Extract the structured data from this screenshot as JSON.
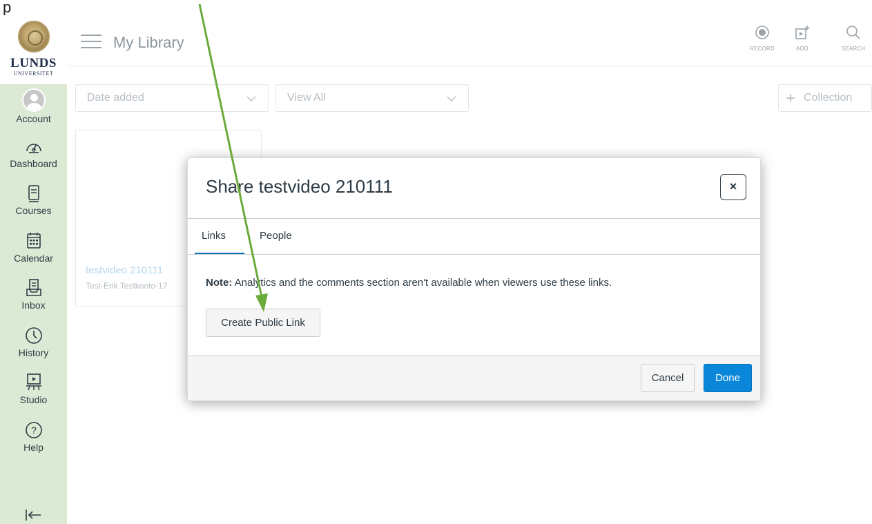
{
  "topstrip": {
    "fragment": "p"
  },
  "logo": {
    "name": "LUNDS",
    "sub": "UNIVERSITET"
  },
  "nav": {
    "items": [
      {
        "label": "Account",
        "icon": "avatar"
      },
      {
        "label": "Dashboard",
        "icon": "dashboard-icon"
      },
      {
        "label": "Courses",
        "icon": "courses-icon"
      },
      {
        "label": "Calendar",
        "icon": "calendar-icon"
      },
      {
        "label": "Inbox",
        "icon": "inbox-icon"
      },
      {
        "label": "History",
        "icon": "history-icon"
      },
      {
        "label": "Studio",
        "icon": "studio-icon"
      },
      {
        "label": "Help",
        "icon": "help-icon"
      }
    ],
    "collapse_icon": "collapse-icon"
  },
  "header": {
    "title": "My Library",
    "tools": [
      {
        "label": "RECORD",
        "icon": "record-icon"
      },
      {
        "label": "ADD",
        "icon": "add-media-icon"
      },
      {
        "label": "SEARCH",
        "icon": "search-icon"
      }
    ]
  },
  "filters": {
    "sort": "Date added",
    "view": "View All",
    "collection_label": "Collection"
  },
  "card": {
    "title": "testvideo 210111",
    "owner": "Test-Erik Testkonto-17"
  },
  "modal": {
    "title": "Share testvideo 210111",
    "close_symbol": "×",
    "tabs": [
      {
        "label": "Links",
        "active": true
      },
      {
        "label": "People",
        "active": false
      }
    ],
    "note_label": "Note:",
    "note_text": " Analytics and the comments section aren't available when viewers use these links.",
    "create_link_label": "Create Public Link",
    "cancel_label": "Cancel",
    "done_label": "Done"
  },
  "colors": {
    "nav_bg": "#dce9d5",
    "primary": "#0b87da",
    "tab_active": "#0374b5",
    "annotation_arrow": "#6aaa3a"
  }
}
